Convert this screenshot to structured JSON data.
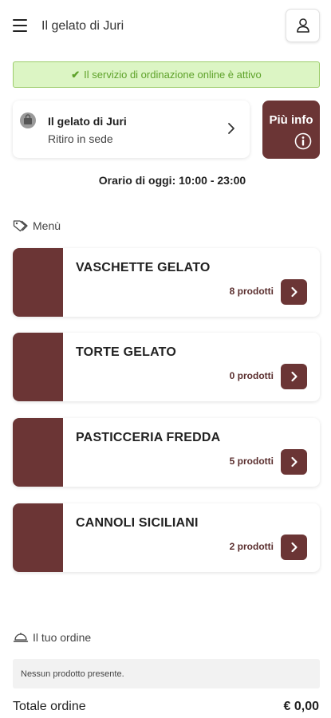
{
  "header": {
    "menu_icon": "hamburger-menu-icon",
    "title": "Il gelato di Juri",
    "user_icon": "user-icon"
  },
  "banner": {
    "icon": "check-icon",
    "text": "Il servizio di ordinazione online è attivo",
    "color": "#5ea22a"
  },
  "store": {
    "icon": "store-bag-icon",
    "name": "Il gelato di Juri",
    "mode": "Ritiro in sede"
  },
  "info_button": {
    "label": "Più info",
    "icon": "info-icon"
  },
  "hours": "Orario di oggi: 10:00 - 23:00",
  "menu_section": {
    "icon": "tag-icon",
    "title": "Menù"
  },
  "categories": [
    {
      "name": "VASCHETTE GELATO",
      "count": "8 prodotti"
    },
    {
      "name": "TORTE GELATO",
      "count": "0 prodotti"
    },
    {
      "name": "PASTICCERIA FREDDA",
      "count": "5 prodotti"
    },
    {
      "name": "CANNOLI SICILIANI",
      "count": "2 prodotti"
    }
  ],
  "order": {
    "icon": "cloche-icon",
    "title": "Il tuo ordine",
    "empty_text": "Nessun prodotto presente.",
    "total_label": "Totale ordine",
    "total_value": "€ 0,00"
  },
  "colors": {
    "brand": "#6b3535",
    "banner_bg": "#dcf5c4",
    "banner_border": "#9ccc6a"
  }
}
